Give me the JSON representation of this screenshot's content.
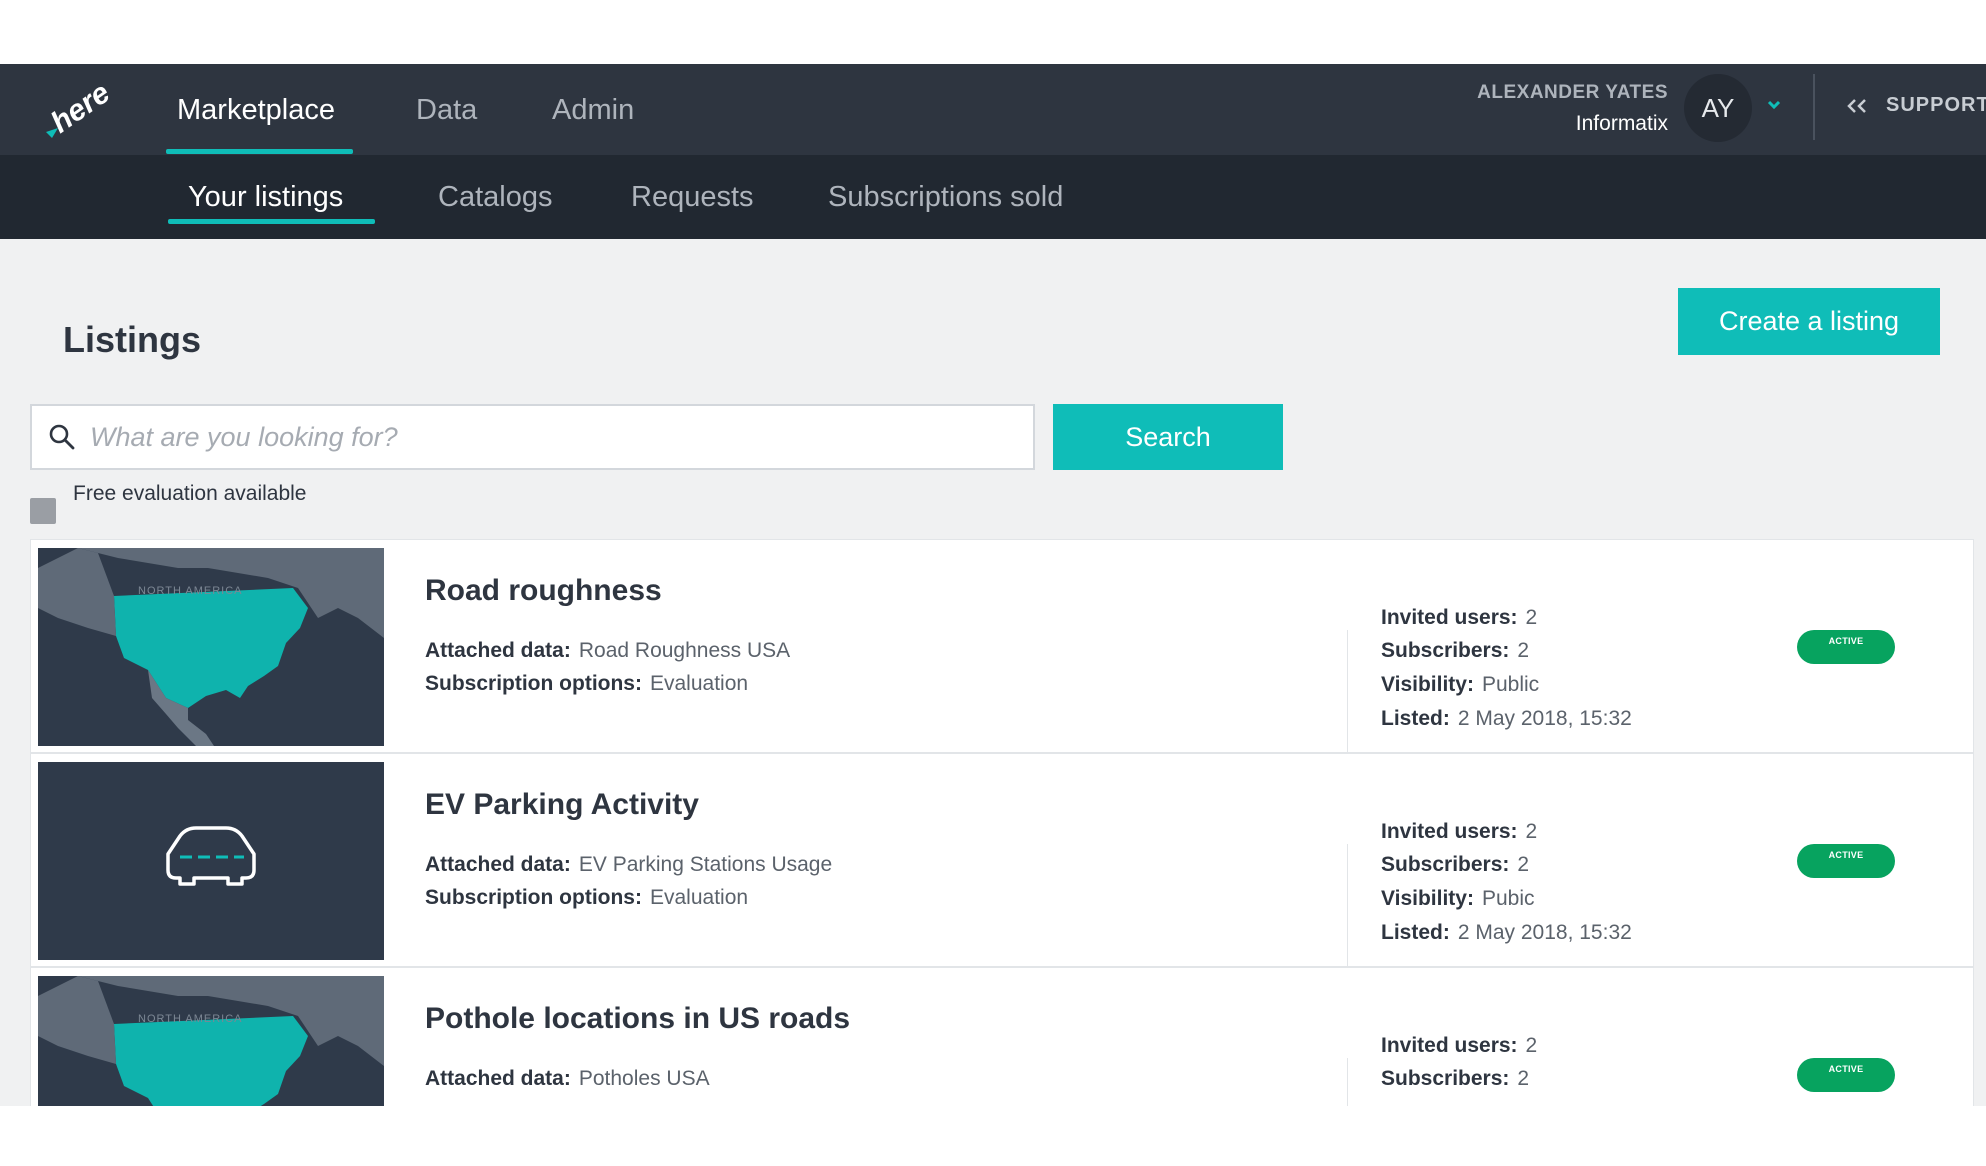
{
  "header": {
    "nav": [
      "Marketplace",
      "Data",
      "Admin"
    ],
    "user_name": "ALEXANDER YATES",
    "user_org": "Informatix",
    "avatar_initials": "AY",
    "support_label": "SUPPORT"
  },
  "subnav": [
    "Your listings",
    "Catalogs",
    "Requests",
    "Subscriptions sold"
  ],
  "page": {
    "title": "Listings",
    "create_label": "Create a listing",
    "search_placeholder": "What are you looking for?",
    "search_label": "Search",
    "filter_label": "Free evaluation available"
  },
  "labels": {
    "attached": "Attached data:",
    "subscription": "Subscription options:",
    "invited": "Invited users:",
    "subscribers": "Subscribers:",
    "visibility": "Visibility:",
    "listed": "Listed:"
  },
  "listings": [
    {
      "title": "Road roughness",
      "thumbnail": "map-north-america",
      "map_label": "NORTH AMERICA",
      "attached": "Road Roughness USA",
      "subscription": "Evaluation",
      "invited": "2",
      "subscribers": "2",
      "visibility": "Public",
      "listed": "2 May 2018, 15:32",
      "status": "ACTIVE"
    },
    {
      "title": "EV Parking Activity",
      "thumbnail": "car-icon",
      "attached": "EV Parking Stations Usage",
      "subscription": "Evaluation",
      "invited": "2",
      "subscribers": "2",
      "visibility": "Pubic",
      "listed": "2 May 2018, 15:32",
      "status": "ACTIVE"
    },
    {
      "title": "Pothole locations in US roads",
      "thumbnail": "map-north-america",
      "map_label": "NORTH AMERICA",
      "attached": "Potholes USA",
      "invited": "2",
      "subscribers": "2",
      "status": "ACTIVE"
    }
  ],
  "colors": {
    "accent": "#0fbdb8",
    "topbar": "#2e3540",
    "subnav": "#212831",
    "active_badge": "#07a35f"
  }
}
